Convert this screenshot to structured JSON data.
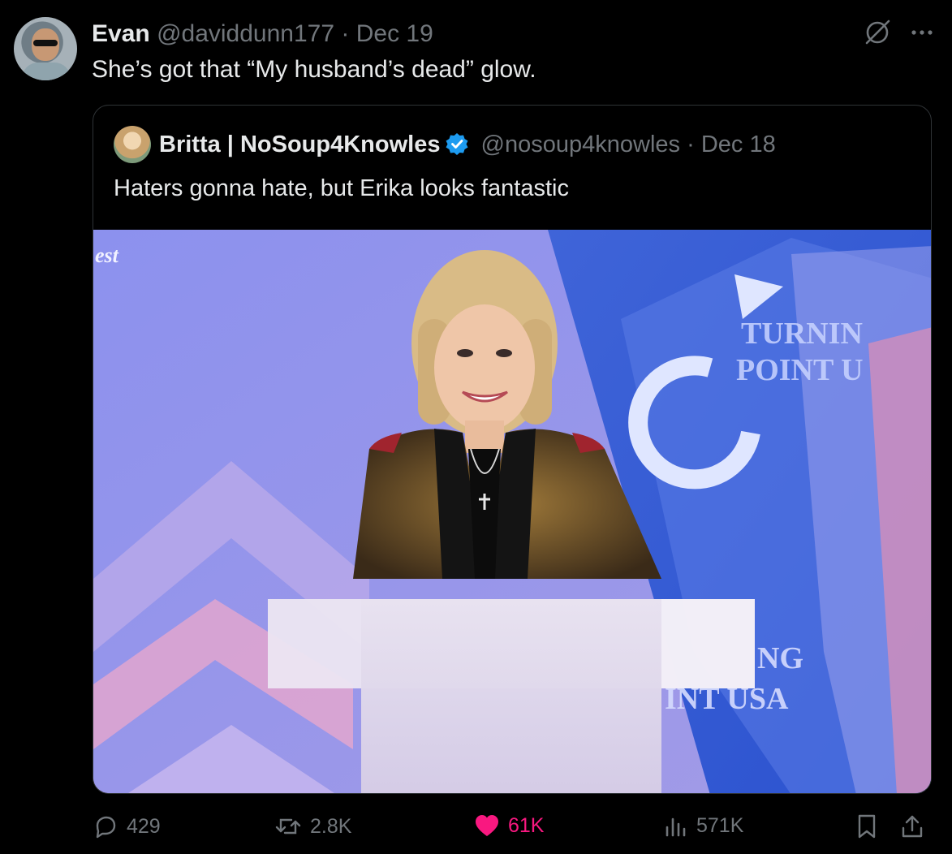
{
  "tweet": {
    "author_name": "Evan",
    "handle": "@daviddunn177",
    "separator": "·",
    "date": "Dec 19",
    "text": "She’s got that “My husband’s dead” glow."
  },
  "quoted": {
    "author_name": "Britta | NoSoup4Knowles",
    "handle": "@nosoup4knowles",
    "separator": "·",
    "date": "Dec 18",
    "text": "Haters gonna hate, but Erika looks fantastic",
    "verified": true
  },
  "media": {
    "signage_left": "est",
    "signage_right_top_1": "TURNIN",
    "signage_right_top_2": "POINT U",
    "signage_right_bottom_1": "NG",
    "signage_right_bottom_2": "INT USA"
  },
  "actions": {
    "replies": "429",
    "reposts": "2.8K",
    "likes": "61K",
    "views": "571K"
  },
  "colors": {
    "background": "#000000",
    "text": "#e7e9ea",
    "muted": "#71767b",
    "like": "#f91880",
    "verified": "#1d9bf0"
  },
  "icons": {
    "grok": "grok-icon",
    "more": "more-icon",
    "reply": "reply-icon",
    "repost": "repost-icon",
    "like": "heart-icon",
    "views": "views-icon",
    "bookmark": "bookmark-icon",
    "share": "share-icon"
  }
}
